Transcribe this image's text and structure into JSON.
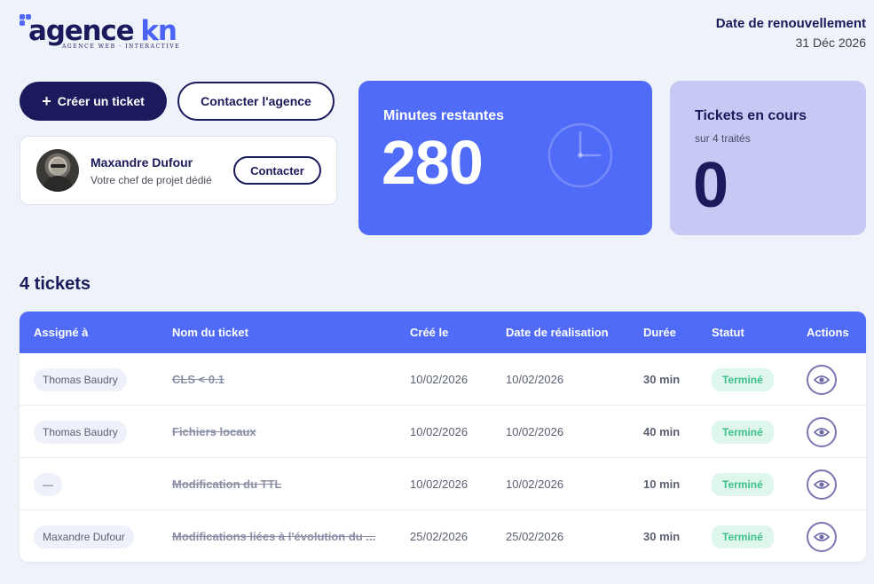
{
  "header": {
    "logo": {
      "word": "agence",
      "suffix": "kn",
      "tagline": "AGENCE WEB · INTERACTIVE"
    },
    "renewal_title": "Date de renouvellement",
    "renewal_date": "31 Déc 2026"
  },
  "actions": {
    "create_ticket": "Créer un ticket",
    "contact_agency": "Contacter l'agence"
  },
  "project_manager": {
    "name": "Maxandre Dufour",
    "role": "Votre chef de projet dédié",
    "contact_label": "Contacter"
  },
  "stats": {
    "minutes_label": "Minutes restantes",
    "minutes_value": "280",
    "tickets_label": "Tickets en cours",
    "tickets_sub": "sur 4 traités",
    "tickets_value": "0",
    "minutes_icon": "clock-icon"
  },
  "tickets": {
    "title": "4 tickets",
    "columns": {
      "assignee": "Assigné à",
      "name": "Nom du ticket",
      "created": "Créé le",
      "done": "Date de réalisation",
      "duration": "Durée",
      "status": "Statut",
      "actions": "Actions"
    },
    "rows": [
      {
        "assignee": "Thomas Baudry",
        "name": "CLS < 0.1",
        "created": "10/02/2026",
        "done": "10/02/2026",
        "duration": "30 min",
        "status": "Terminé"
      },
      {
        "assignee": "Thomas Baudry",
        "name": "Fichiers locaux",
        "created": "10/02/2026",
        "done": "10/02/2026",
        "duration": "40 min",
        "status": "Terminé"
      },
      {
        "assignee": "—",
        "name": "Modification du TTL",
        "created": "10/02/2026",
        "done": "10/02/2026",
        "duration": "10 min",
        "status": "Terminé"
      },
      {
        "assignee": "Maxandre Dufour",
        "name": "Modifications liées à l'évolution du ...",
        "created": "25/02/2026",
        "done": "25/02/2026",
        "duration": "30 min",
        "status": "Terminé"
      }
    ],
    "action_icon": "eye-icon"
  },
  "colors": {
    "navy": "#1b1a5c",
    "accent": "#4f6bf8",
    "lavender": "#c7c8f3",
    "status_green": "#3ec08a"
  }
}
